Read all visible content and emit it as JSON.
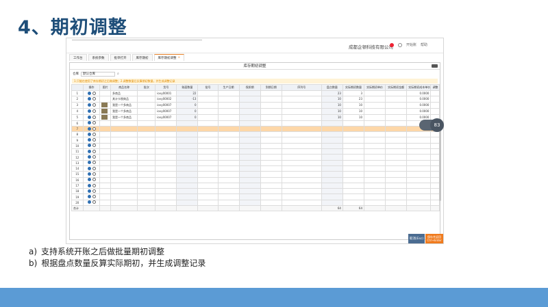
{
  "slide": {
    "title": "4、期初调整",
    "bullets": [
      {
        "marker": "a)",
        "text": "支持系统开账之后做批量期初调整"
      },
      {
        "marker": "b)",
        "text": "根据盘点数量反算实际期初，并生成调整记录"
      }
    ]
  },
  "app": {
    "company": "成都企顿科技有限公司",
    "badge": "8",
    "header_right": [
      "开始账",
      "帮助"
    ],
    "tabs": [
      {
        "label": "工作台"
      },
      {
        "label": "系统参数"
      },
      {
        "label": "批单打开"
      },
      {
        "label": "库存期初"
      },
      {
        "label": "库存期初调整",
        "active": true
      }
    ],
    "panel_title": "库存期初调整",
    "storage_label": "仓库",
    "storage_value": "默认仓库",
    "warning": "1.只能在使用了库存期初之后做调整；2.调整数量后反算期初数量，并生成调整记录",
    "columns": [
      "",
      "操作",
      "图片",
      "商品名称",
      "批次",
      "货号",
      "账面数量",
      "批号",
      "生产日期",
      "保质期",
      "到期日期",
      "序列号",
      "盘点数量",
      "实际期初数量",
      "实际期初单价",
      "实际期初金额",
      "实际期初成本单价",
      "调整"
    ],
    "rows": [
      {
        "no": "1",
        "name": "多商品",
        "code": "iovy00001",
        "qty": "22",
        "count": "23",
        "init_qty": "3",
        "cost": "0.0000",
        "img": false
      },
      {
        "no": "2",
        "name": "其计卡税商品",
        "code": "iovy00002",
        "qty": "-13",
        "count": "10",
        "init_qty": "23",
        "cost": "0.0000",
        "img": false
      },
      {
        "no": "3",
        "name": "我是一个多商品",
        "code": "iovy00007",
        "qty": "0",
        "count": "10",
        "init_qty": "10",
        "cost": "0.0000",
        "img": true
      },
      {
        "no": "4",
        "name": "我是一个多商品",
        "code": "iovy00007",
        "qty": "0",
        "count": "10",
        "init_qty": "10",
        "cost": "0.0000",
        "img": true
      },
      {
        "no": "5",
        "name": "我是一个多商品",
        "code": "iovy00007",
        "qty": "0",
        "count": "10",
        "init_qty": "10",
        "cost": "0.0000",
        "img": true
      },
      {
        "no": "6"
      },
      {
        "no": "7"
      },
      {
        "no": "8"
      },
      {
        "no": "9"
      },
      {
        "no": "10"
      },
      {
        "no": "11"
      },
      {
        "no": "12"
      },
      {
        "no": "13"
      },
      {
        "no": "14"
      },
      {
        "no": "15"
      },
      {
        "no": "16"
      },
      {
        "no": "17"
      },
      {
        "no": "18"
      },
      {
        "no": "19"
      },
      {
        "no": "20"
      }
    ],
    "selected_row": 7,
    "total_label": "合计",
    "total_count": "64",
    "total_init_qty": "64",
    "float_text": "83",
    "cancel_label": "取消(Esc)",
    "save_label": "保存并返回",
    "save_shortcut": "Ctrl+Enter"
  },
  "colors": {
    "title": "#1e4e79",
    "footer": "#5b9bd5",
    "accent": "#f07b1e"
  }
}
